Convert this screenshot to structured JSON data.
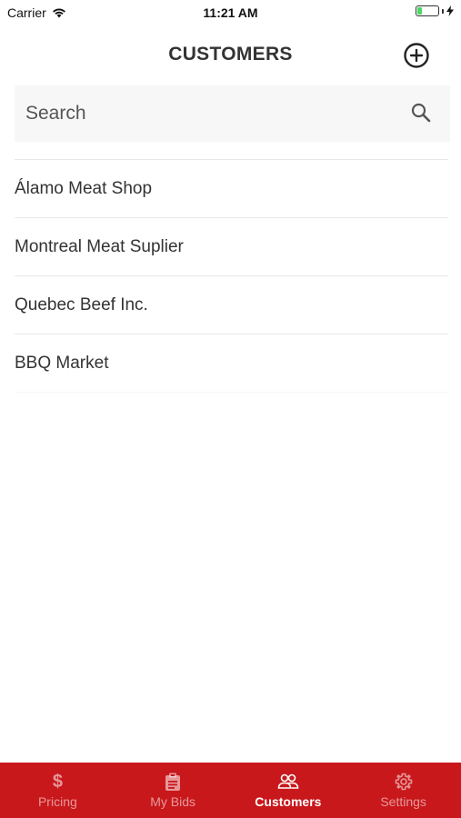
{
  "status_bar": {
    "carrier": "Carrier",
    "time": "11:21 AM",
    "battery_level": 0.25,
    "battery_color": "#4cd964",
    "wifi_icon": "wifi-icon",
    "charging_icon": "bolt-icon"
  },
  "header": {
    "title": "CUSTOMERS",
    "add_icon": "plus-circle-icon"
  },
  "search": {
    "placeholder": "Search",
    "value": "",
    "icon": "search-icon"
  },
  "customers": [
    {
      "name": "Álamo Meat Shop"
    },
    {
      "name": "Montreal Meat Suplier"
    },
    {
      "name": "Quebec Beef Inc."
    },
    {
      "name": "BBQ Market"
    }
  ],
  "tab_bar": {
    "background_color": "#c8181c",
    "active_tab": "Customers",
    "tabs": [
      {
        "label": "Pricing",
        "icon": "dollar-icon"
      },
      {
        "label": "My Bids",
        "icon": "clipboard-icon"
      },
      {
        "label": "Customers",
        "icon": "people-icon"
      },
      {
        "label": "Settings",
        "icon": "gear-icon"
      }
    ]
  }
}
